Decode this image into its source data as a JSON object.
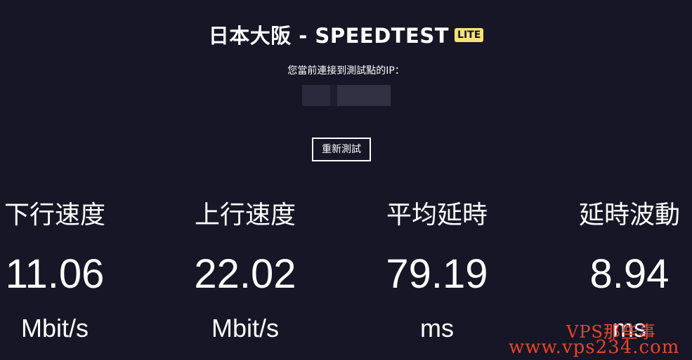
{
  "header": {
    "title": "日本大阪 - SPEEDTEST",
    "badge": "LITE",
    "badge_color": "#f6e27a"
  },
  "connection": {
    "ip_label": "您當前連接到測試點的IP："
  },
  "actions": {
    "retest_label": "重新測試"
  },
  "metrics": [
    {
      "label": "下行速度",
      "value": "11.06",
      "unit": "Mbit/s"
    },
    {
      "label": "上行速度",
      "value": "22.02",
      "unit": "Mbit/s"
    },
    {
      "label": "平均延時",
      "value": "79.19",
      "unit": "ms"
    },
    {
      "label": "延時波動",
      "value": "8.94",
      "unit": "ms"
    }
  ],
  "watermark": {
    "line1": "VPS那些事",
    "line2": "www.vps234.com",
    "color": "#e8442a"
  },
  "colors": {
    "background": "#161626",
    "text": "#ffffff"
  }
}
